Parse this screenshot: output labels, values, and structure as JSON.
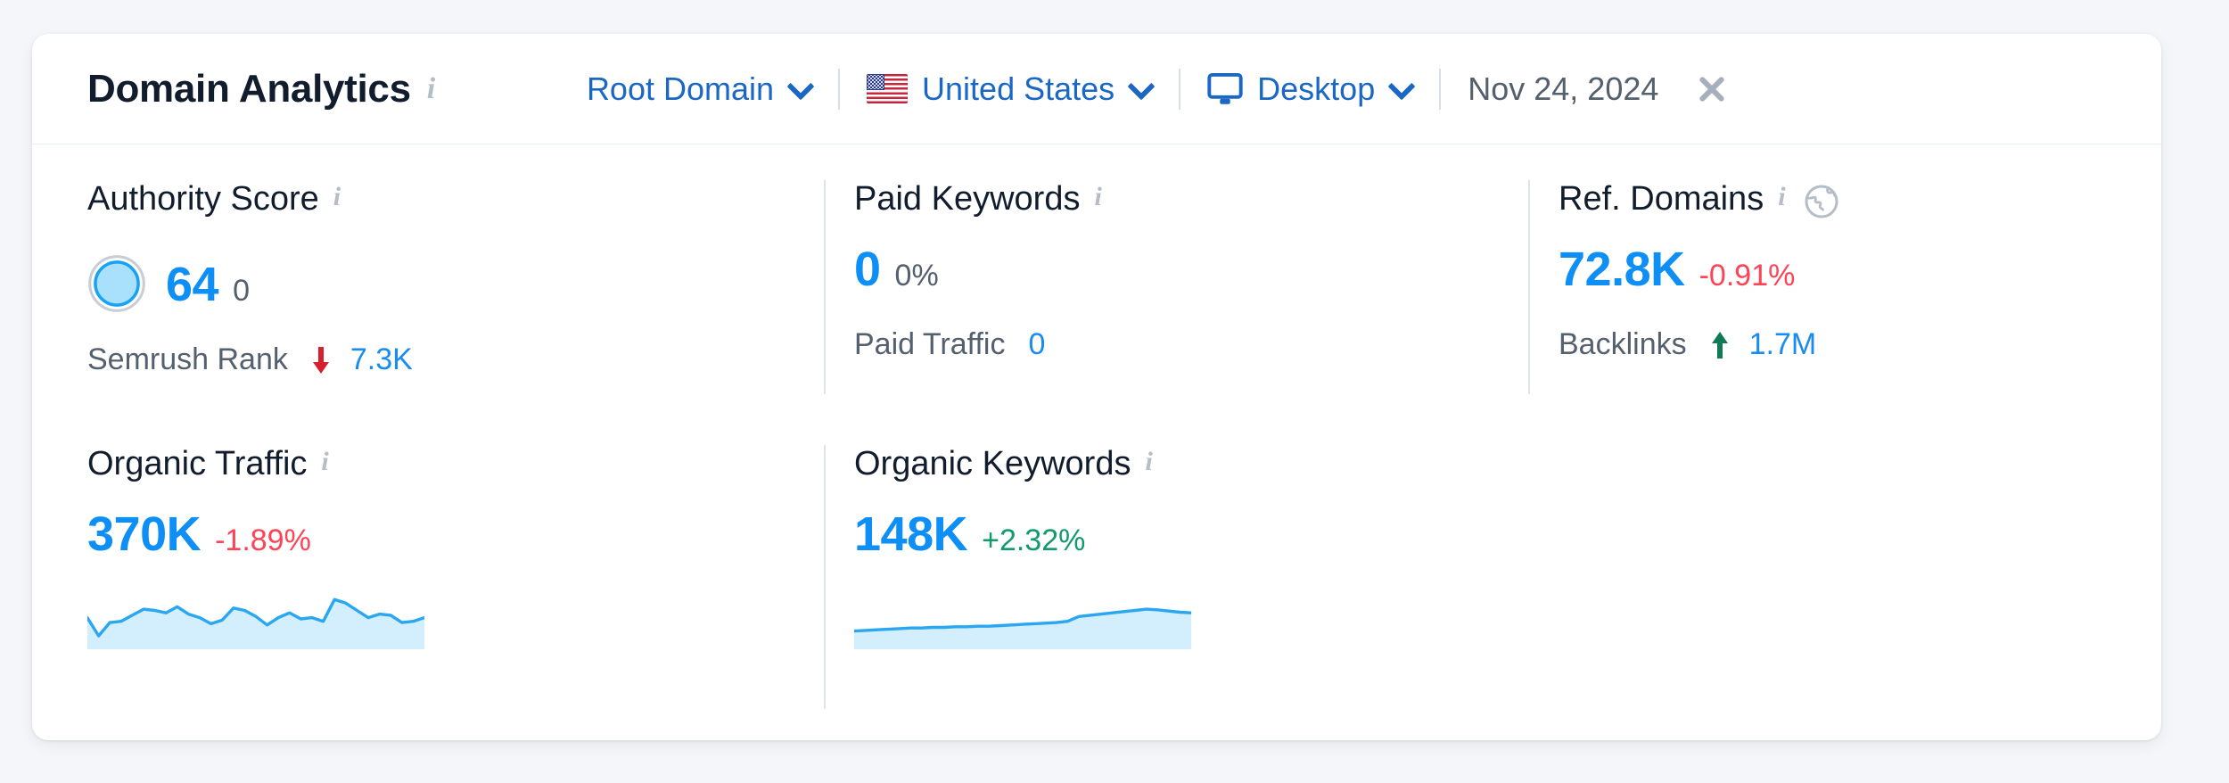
{
  "header": {
    "title": "Domain Analytics",
    "title_info_icon": "info-icon",
    "scope": {
      "label": "Root Domain",
      "chevron": "chevron-down-icon"
    },
    "country": {
      "label": "United States",
      "flag": "us-flag-icon",
      "chevron": "chevron-down-icon"
    },
    "device": {
      "label": "Desktop",
      "icon": "monitor-icon",
      "chevron": "chevron-down-icon"
    },
    "date": "Nov 24, 2024",
    "close_icon": "close-icon"
  },
  "colors": {
    "accent_blue": "#0d8ff5",
    "link_blue": "#1a67c4",
    "negative_red": "#ff4356",
    "positive_green": "#119a6d",
    "muted_gray": "#55606e",
    "spark_fill": "#d3effd",
    "spark_line": "#2aa7f0"
  },
  "metrics": {
    "authority_score": {
      "label": "Authority Score",
      "info_icon": "info-icon",
      "value": "64",
      "delta": "0",
      "gauge_icon": "authority-gauge-icon",
      "sub_label": "Semrush Rank",
      "sub_trend": "down",
      "sub_value": "7.3K"
    },
    "paid_keywords": {
      "label": "Paid Keywords",
      "info_icon": "info-icon",
      "value": "0",
      "delta": "0%",
      "sub_label": "Paid Traffic",
      "sub_trend": "none",
      "sub_value": "0"
    },
    "ref_domains": {
      "label": "Ref. Domains",
      "info_icon": "info-icon",
      "globe_icon": "globe-icon",
      "value": "72.8K",
      "delta": "-0.91%",
      "sub_label": "Backlinks",
      "sub_trend": "up",
      "sub_value": "1.7M"
    },
    "organic_traffic": {
      "label": "Organic Traffic",
      "info_icon": "info-icon",
      "value": "370K",
      "delta": "-1.89%"
    },
    "organic_keywords": {
      "label": "Organic Keywords",
      "info_icon": "info-icon",
      "value": "148K",
      "delta": "+2.32%"
    }
  },
  "chart_data": [
    {
      "type": "area",
      "name": "organic-traffic-sparkline",
      "title": "Organic Traffic",
      "xlabel": "",
      "ylabel": "",
      "grid": false,
      "legend": "none",
      "x": [
        0,
        1,
        2,
        3,
        4,
        5,
        6,
        7,
        8,
        9,
        10,
        11,
        12,
        13,
        14,
        15,
        16,
        17,
        18,
        19,
        20,
        21,
        22,
        23,
        24,
        25,
        26,
        27,
        28,
        29,
        30
      ],
      "values": [
        52,
        22,
        44,
        46,
        56,
        66,
        64,
        60,
        70,
        58,
        52,
        42,
        48,
        68,
        64,
        54,
        40,
        52,
        60,
        50,
        52,
        46,
        82,
        76,
        64,
        52,
        58,
        56,
        44,
        46,
        52
      ],
      "ylim": [
        0,
        100
      ]
    },
    {
      "type": "area",
      "name": "organic-keywords-sparkline",
      "title": "Organic Keywords",
      "xlabel": "",
      "ylabel": "",
      "grid": false,
      "legend": "none",
      "x": [
        0,
        1,
        2,
        3,
        4,
        5,
        6,
        7,
        8,
        9,
        10,
        11,
        12,
        13,
        14,
        15,
        16,
        17,
        18,
        19,
        20,
        21,
        22,
        23,
        24,
        25,
        26,
        27,
        28,
        29,
        30
      ],
      "values": [
        30,
        31,
        32,
        33,
        34,
        35,
        35,
        36,
        36,
        37,
        37,
        38,
        38,
        39,
        40,
        41,
        42,
        43,
        44,
        46,
        54,
        56,
        58,
        60,
        62,
        64,
        66,
        65,
        63,
        61,
        60
      ],
      "ylim": [
        0,
        100
      ]
    }
  ]
}
